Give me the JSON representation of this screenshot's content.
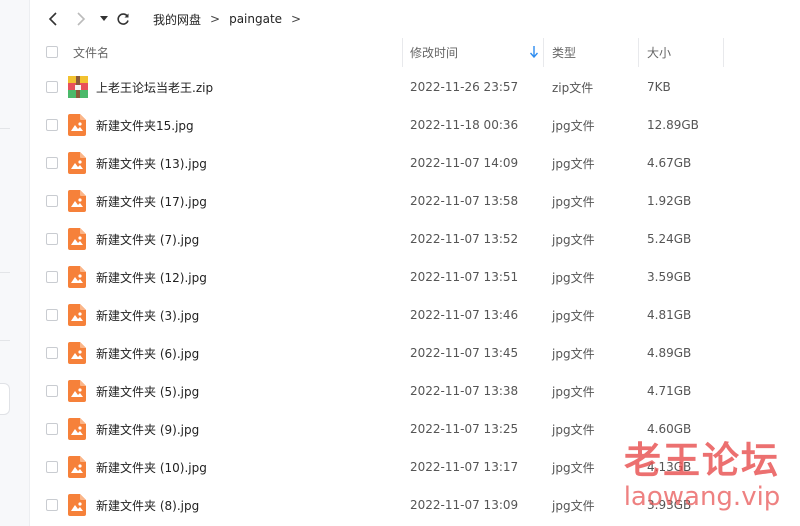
{
  "toolbar": {
    "breadcrumb": [
      "我的网盘",
      "paingate"
    ],
    "separator": ">"
  },
  "columns": {
    "name": "文件名",
    "modified": "修改时间",
    "type": "类型",
    "size": "大小"
  },
  "files": [
    {
      "name": "上老王论坛当老王.zip",
      "modified": "2022-11-26 23:57",
      "type": "zip文件",
      "size": "7KB",
      "icon": "zip-archive-icon"
    },
    {
      "name": "新建文件夹15.jpg",
      "modified": "2022-11-18 00:36",
      "type": "jpg文件",
      "size": "12.89GB",
      "icon": "image-file-icon"
    },
    {
      "name": "新建文件夹 (13).jpg",
      "modified": "2022-11-07 14:09",
      "type": "jpg文件",
      "size": "4.67GB",
      "icon": "image-file-icon"
    },
    {
      "name": "新建文件夹 (17).jpg",
      "modified": "2022-11-07 13:58",
      "type": "jpg文件",
      "size": "1.92GB",
      "icon": "image-file-icon"
    },
    {
      "name": "新建文件夹 (7).jpg",
      "modified": "2022-11-07 13:52",
      "type": "jpg文件",
      "size": "5.24GB",
      "icon": "image-file-icon"
    },
    {
      "name": "新建文件夹 (12).jpg",
      "modified": "2022-11-07 13:51",
      "type": "jpg文件",
      "size": "3.59GB",
      "icon": "image-file-icon"
    },
    {
      "name": "新建文件夹 (3).jpg",
      "modified": "2022-11-07 13:46",
      "type": "jpg文件",
      "size": "4.81GB",
      "icon": "image-file-icon"
    },
    {
      "name": "新建文件夹 (6).jpg",
      "modified": "2022-11-07 13:45",
      "type": "jpg文件",
      "size": "4.89GB",
      "icon": "image-file-icon"
    },
    {
      "name": "新建文件夹 (5).jpg",
      "modified": "2022-11-07 13:38",
      "type": "jpg文件",
      "size": "4.71GB",
      "icon": "image-file-icon"
    },
    {
      "name": "新建文件夹 (9).jpg",
      "modified": "2022-11-07 13:25",
      "type": "jpg文件",
      "size": "4.60GB",
      "icon": "image-file-icon"
    },
    {
      "name": "新建文件夹 (10).jpg",
      "modified": "2022-11-07 13:17",
      "type": "jpg文件",
      "size": "4.13GB",
      "icon": "image-file-icon"
    },
    {
      "name": "新建文件夹 (8).jpg",
      "modified": "2022-11-07 13:09",
      "type": "jpg文件",
      "size": "3.93GB",
      "icon": "image-file-icon"
    }
  ],
  "watermark": {
    "title": "老王论坛",
    "url": "laowang.vip"
  },
  "colors": {
    "image_icon": "#f6813a",
    "zip_icon": "#3fa7e8",
    "sort_arrow": "#2d8cf0",
    "watermark": "#e85050"
  }
}
